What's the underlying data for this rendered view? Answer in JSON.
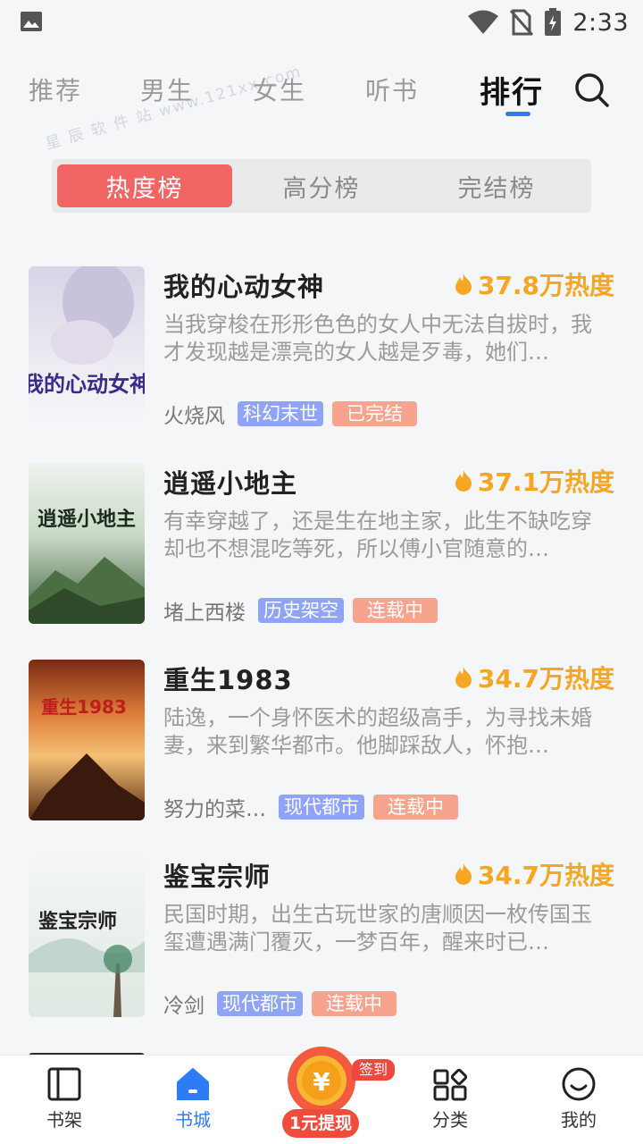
{
  "status_bar": {
    "time": "2:33",
    "icons": [
      "image-icon",
      "wifi-icon",
      "no-sim-icon",
      "battery-icon"
    ]
  },
  "top_tabs": {
    "items": [
      {
        "label": "推荐"
      },
      {
        "label": "男生"
      },
      {
        "label": "女生"
      },
      {
        "label": "听书"
      },
      {
        "label": "排行",
        "active": true
      }
    ],
    "search_icon": "search-icon",
    "watermark": "星 辰 软 件 站 www.121xx.com"
  },
  "ranking_tabs": {
    "items": [
      {
        "label": "热度榜",
        "active": true
      },
      {
        "label": "高分榜"
      },
      {
        "label": "完结榜"
      }
    ]
  },
  "books": [
    {
      "title": "我的心动女神",
      "heat": "37.8万热度",
      "desc": "当我穿梭在形形色色的女人中无法自拔时，我才发现越是漂亮的女人越是歹毒，她们…",
      "author": "火烧风",
      "category": "科幻末世",
      "status": "已完结",
      "cover_text": "我的心动女神"
    },
    {
      "title": "逍遥小地主",
      "heat": "37.1万热度",
      "desc": "有幸穿越了，还是生在地主家，此生不缺吃穿却也不想混吃等死，所以傅小官随意的…",
      "author": "堵上西楼",
      "category": "历史架空",
      "status": "连载中",
      "cover_text": "逍遥小地主"
    },
    {
      "title": "重生1983",
      "heat": "34.7万热度",
      "desc": "陆逸，一个身怀医术的超级高手，为寻找未婚妻，来到繁华都市。他脚踩敌人，怀抱…",
      "author": "努力的菜…",
      "category": "现代都市",
      "status": "连载中",
      "cover_text": "重生1983"
    },
    {
      "title": "鉴宝宗师",
      "heat": "34.7万热度",
      "desc": "民国时期，出生古玩世家的唐顺因一枚传国玉玺遭遇满门覆灭，一梦百年，醒来时已…",
      "author": "冷剑",
      "category": "现代都市",
      "status": "连载中",
      "cover_text": "鉴宝宗师"
    }
  ],
  "bottom_nav": {
    "items": [
      {
        "label": "书架",
        "icon": "bookshelf-icon"
      },
      {
        "label": "书城",
        "icon": "home-icon",
        "active": true
      },
      {
        "label": "分类",
        "icon": "category-icon"
      },
      {
        "label": "我的",
        "icon": "profile-icon"
      }
    ],
    "promo": {
      "badge": "签到",
      "label": "1元提现",
      "icon": "coin-icon"
    }
  },
  "colors": {
    "accent": "#2d7cf6",
    "ranking_active": "#f26565",
    "heat": "#f5a623",
    "category_tag": "#8fa3f7",
    "status_tag": "#f7a48e"
  }
}
